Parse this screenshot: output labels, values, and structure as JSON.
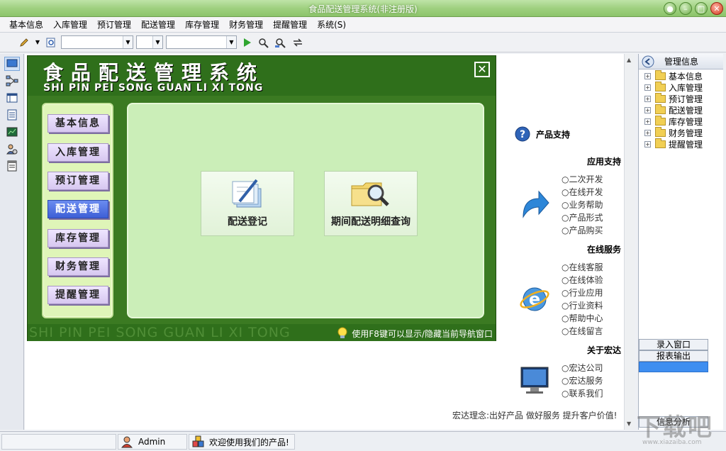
{
  "window": {
    "title": "食品配送管理系统(非注册版)"
  },
  "menu": [
    "基本信息",
    "入库管理",
    "预订管理",
    "配送管理",
    "库存管理",
    "财务管理",
    "提醒管理",
    "系统(S)"
  ],
  "nav": {
    "title": "食品配送管理系统",
    "pinyin": "SHI PIN PEI SONG GUAN LI XI TONG",
    "menu_buttons": [
      "基本信息",
      "入库管理",
      "预订管理",
      "配送管理",
      "库存管理",
      "财务管理",
      "提醒管理"
    ],
    "active_index": 3,
    "tiles": [
      "配送登记",
      "期间配送明细查询"
    ],
    "footer_pinyin": "SHI PIN PEI SONG GUAN LI XI TONG",
    "footer_hint": "使用F8键可以显示/隐藏当前导航窗口"
  },
  "support": {
    "header": "产品支持",
    "sections": [
      {
        "title": "应用支持",
        "links": [
          "二次开发",
          "在线开发",
          "业务帮助",
          "产品形式",
          "产品购买"
        ]
      },
      {
        "title": "在线服务",
        "links": [
          "在线客服",
          "在线体验",
          "行业应用",
          "行业资料",
          "帮助中心",
          "在线留言"
        ]
      },
      {
        "title": "关于宏达",
        "links": [
          "宏达公司",
          "宏达服务",
          "联系我们"
        ]
      }
    ],
    "slogan": "宏达理念:出好产品 做好服务 提升客户价值!"
  },
  "right_panel": {
    "title": "管理信息",
    "tree": [
      "基本信息",
      "入库管理",
      "预订管理",
      "配送管理",
      "库存管理",
      "财务管理",
      "提醒管理"
    ],
    "tabs": [
      "录入窗口",
      "报表输出",
      "",
      "信息分析"
    ]
  },
  "status": {
    "user": "Admin",
    "message": "欢迎使用我们的产品!"
  },
  "watermark": {
    "text": "下载吧",
    "small": "www.xiazaiba.com"
  }
}
